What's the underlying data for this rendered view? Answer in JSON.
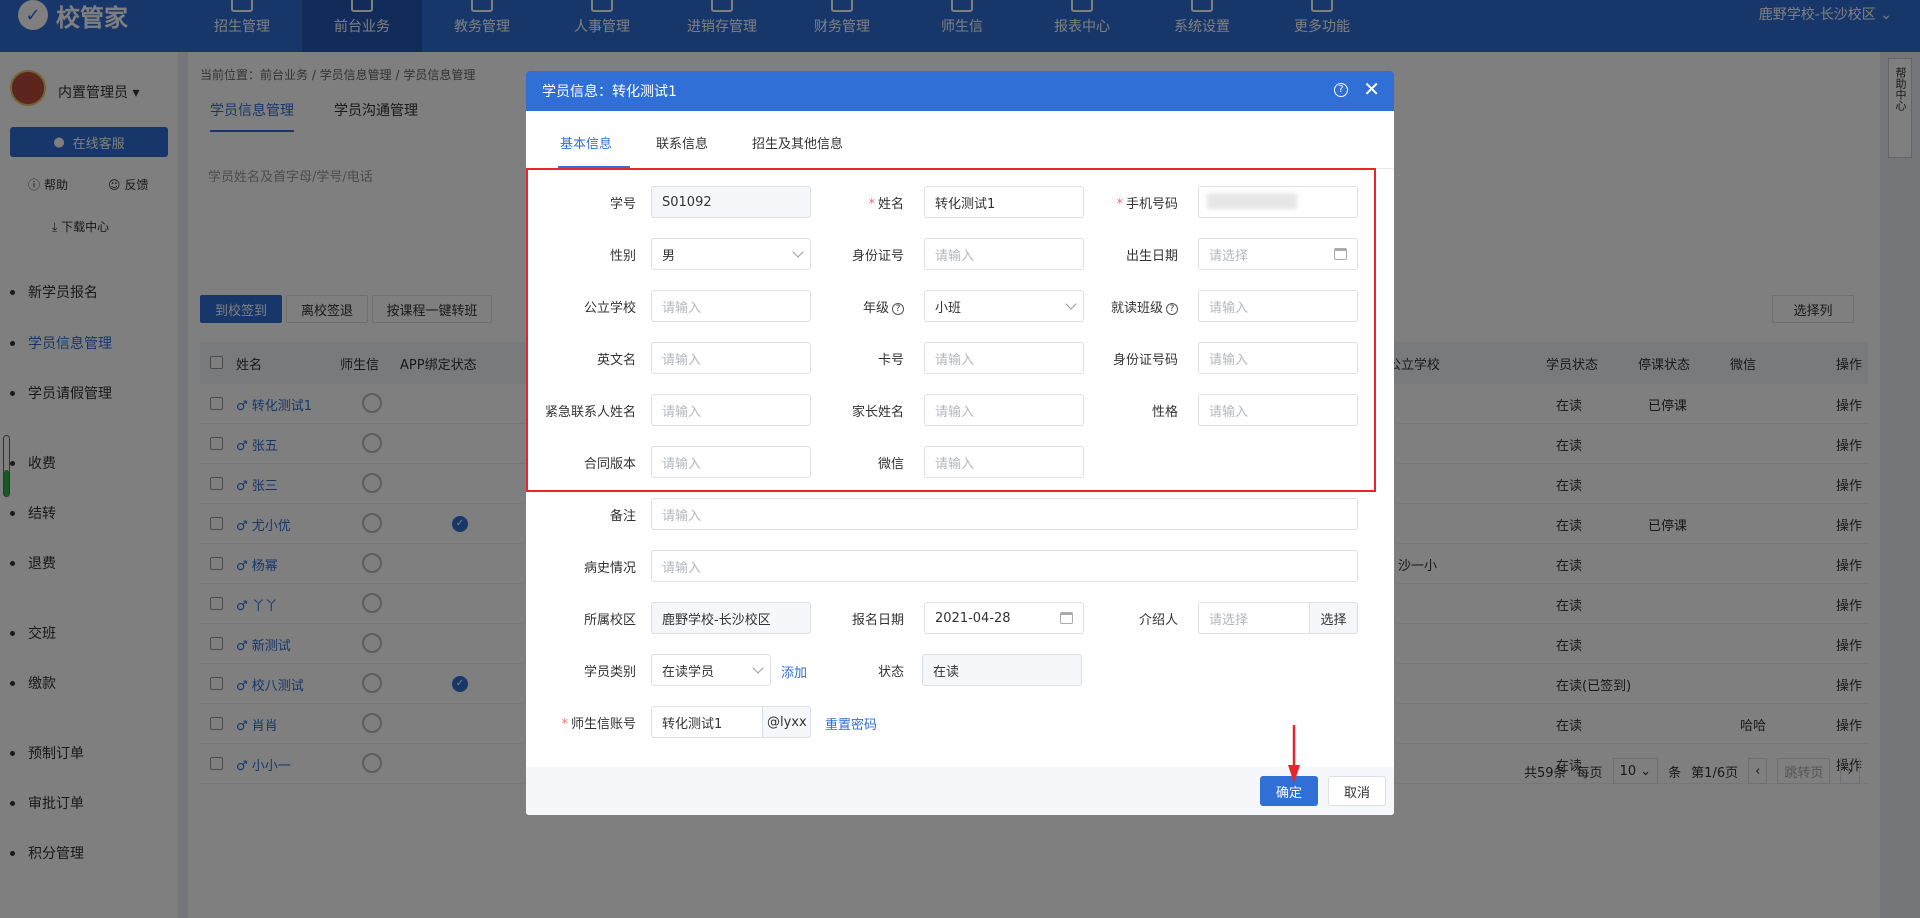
{
  "app": {
    "logo": "校管家",
    "campus": "鹿野学校-长沙校区"
  },
  "topnav": [
    "招生管理",
    "前台业务",
    "教务管理",
    "人事管理",
    "进销存管理",
    "财务管理",
    "师生信",
    "报表中心",
    "系统设置",
    "更多功能"
  ],
  "sidebar": {
    "user": "内置管理员",
    "online": "在线客服",
    "help": "帮助",
    "feedback": "反馈",
    "download": "下载中心",
    "items": [
      "新学员报名",
      "学员信息管理",
      "学员请假管理",
      "收费",
      "结转",
      "退费",
      "交班",
      "缴款",
      "预制订单",
      "审批订单",
      "积分管理"
    ]
  },
  "page": {
    "breadcrumb": "当前位置：前台业务 / 学员信息管理 / 学员信息管理",
    "tabs": [
      "学员信息管理",
      "学员沟通管理"
    ],
    "search_hint": "学员姓名及首字母/学号/电话",
    "actions": [
      "到校签到",
      "离校签退",
      "按课程一键转班"
    ],
    "select_cols": "选择列",
    "headers": {
      "name": "姓名",
      "shengxin": "师生信",
      "app": "APP绑定状态",
      "school": "公立学校",
      "status": "学员状态",
      "stop": "停课状态",
      "wechat": "微信",
      "op": "操作"
    },
    "rows": [
      {
        "name": "转化测试1",
        "status": "在读",
        "stop": "已停课",
        "wechat": "",
        "op": "操作"
      },
      {
        "name": "张五",
        "status": "在读",
        "stop": "",
        "wechat": "",
        "op": "操作"
      },
      {
        "name": "张三",
        "status": "在读",
        "stop": "",
        "wechat": "",
        "op": "操作"
      },
      {
        "name": "尤小优",
        "status": "在读",
        "stop": "已停课",
        "wechat": "",
        "op": "操作"
      },
      {
        "name": "杨幂",
        "status": "在读",
        "stop": "",
        "wechat": "",
        "op": "操作"
      },
      {
        "name": "丫丫",
        "status": "在读",
        "stop": "",
        "wechat": "",
        "op": "操作"
      },
      {
        "name": "新测试",
        "status": "在读",
        "stop": "",
        "wechat": "",
        "op": "操作"
      },
      {
        "name": "校八测试",
        "status": "在读(已签到)",
        "stop": "",
        "wechat": "",
        "op": "操作"
      },
      {
        "name": "肖肖",
        "status": "在读",
        "stop": "",
        "wechat": "哈哈",
        "op": "操作"
      },
      {
        "name": "小小一",
        "status": "在读",
        "stop": "",
        "wechat": "",
        "op": "操作"
      }
    ],
    "school_partial": "沙一小",
    "pager": {
      "total": "共59条",
      "per": "每页",
      "size": "10",
      "unit": "条",
      "page": "第1/6页",
      "jump": "跳转页"
    },
    "help_side": "帮助中心"
  },
  "modal": {
    "title": "学员信息：转化测试1",
    "tabs": [
      "基本信息",
      "联系信息",
      "招生及其他信息"
    ],
    "placeholder": "请输入",
    "placeholder_select": "请选择",
    "fields": {
      "student_no": {
        "label": "学号",
        "value": "S01092"
      },
      "name": {
        "label": "姓名",
        "value": "转化测试1"
      },
      "phone": {
        "label": "手机号码"
      },
      "gender": {
        "label": "性别",
        "value": "男"
      },
      "id_no": {
        "label": "身份证号"
      },
      "birthday": {
        "label": "出生日期"
      },
      "public_school": {
        "label": "公立学校"
      },
      "grade": {
        "label": "年级",
        "value": "小班"
      },
      "class": {
        "label": "就读班级"
      },
      "english_name": {
        "label": "英文名"
      },
      "card_no": {
        "label": "卡号"
      },
      "id_code": {
        "label": "身份证号码"
      },
      "emergency": {
        "label": "紧急联系人姓名"
      },
      "parent": {
        "label": "家长姓名"
      },
      "character": {
        "label": "性格"
      },
      "contract": {
        "label": "合同版本"
      },
      "wechat": {
        "label": "微信"
      },
      "remark": {
        "label": "备注"
      },
      "medical": {
        "label": "病史情况"
      },
      "campus": {
        "label": "所属校区",
        "value": "鹿野学校-长沙校区"
      },
      "enroll_date": {
        "label": "报名日期",
        "value": "2021-04-28"
      },
      "referrer": {
        "label": "介绍人",
        "button": "选择"
      },
      "category": {
        "label": "学员类别",
        "value": "在读学员",
        "link": "添加"
      },
      "status": {
        "label": "状态",
        "value": "在读"
      },
      "account": {
        "label": "师生信账号",
        "value": "转化测试1",
        "suffix": "@lyxx",
        "link": "重置密码"
      }
    },
    "ok": "确定",
    "cancel": "取消"
  },
  "colors": {
    "primary": "#2f6fd6",
    "highlight_box": "#e6262b",
    "required": "#f56c6c"
  }
}
